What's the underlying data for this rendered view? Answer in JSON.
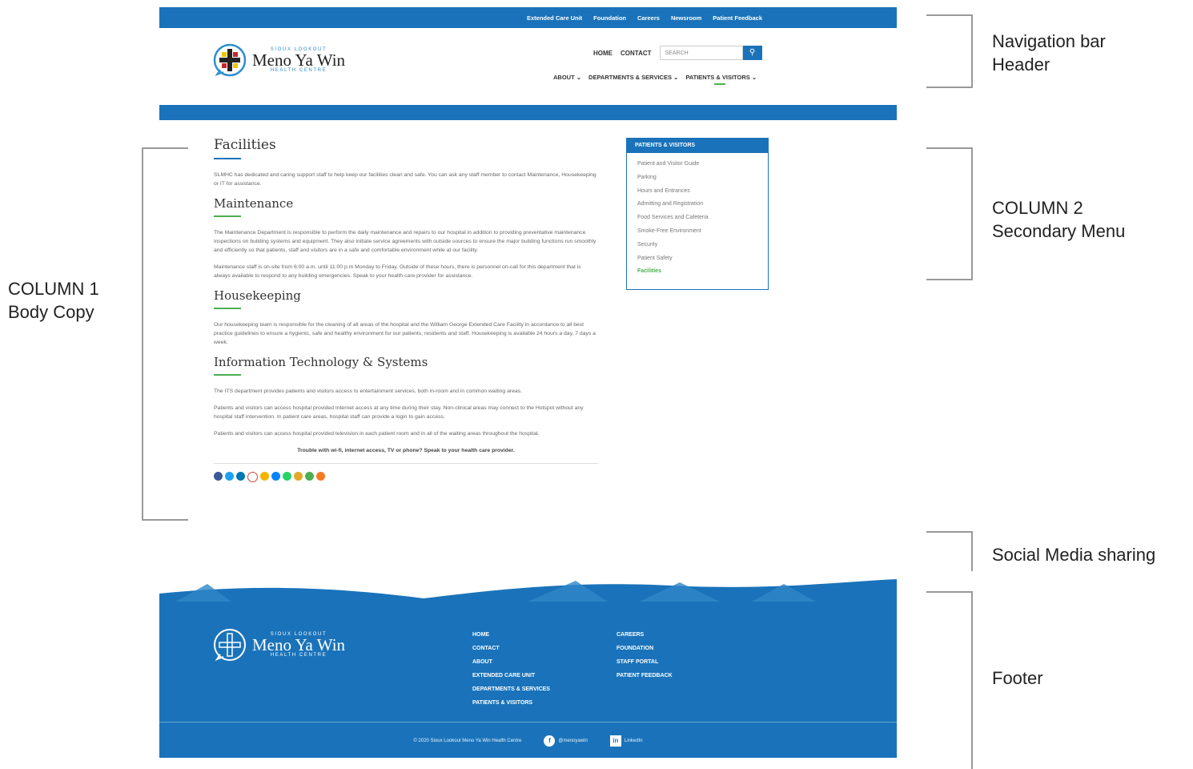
{
  "topbar": {
    "links": [
      "Extended Care Unit",
      "Foundation",
      "Careers",
      "Newsroom",
      "Patient Feedback"
    ]
  },
  "logo": {
    "line1": "SIOUX LOOKOUT",
    "line2": "Meno Ya Win",
    "line3": "HEALTH CENTRE"
  },
  "utility": {
    "home": "HOME",
    "contact": "CONTACT",
    "search_placeholder": "SEARCH",
    "search_icon": "search-icon"
  },
  "mainnav": [
    "ABOUT ⌄",
    "DEPARTMENTS & SERVICES ⌄",
    "PATIENTS & VISITORS ⌄"
  ],
  "content": {
    "title": "Facilities",
    "intro": "SLMHC has dedicated and caring support staff to help keep our facilities clean and safe.   You can ask any staff member to contact Maintenance, Housekeeping or IT for assistance.",
    "maintenance": {
      "heading": "Maintenance",
      "p1": "The Maintenance Department is responsible to perform the daily maintenance and repairs to our hospital in addition to providing preventative maintenance inspections on building systems and equipment. They also initiate service agreements with outside sources to ensure the major building functions run smoothly and efficiently so that patients, staff and visitors are in a safe and comfortable environment while at our facility.",
      "p2": "Maintenance staff is on-site from 6:00 a.m. until 11:00 p.m Monday to Friday. Outside of these hours, there is personnel on-call for this department that is always available to respond to any building emergencies.  Speak to your health care provider for assistance."
    },
    "housekeeping": {
      "heading": "Housekeeping",
      "p1": "Our housekeeping team is responsible for the cleaning of all areas of the hospital and the William George Extended Care Facility in accordance to all best practice guidelines to ensure a hygienic, safe and healthy environment for our patients, residents and staff. Housekeeping is available 24 hours a day, 7 days a week."
    },
    "its": {
      "heading": "Information Technology & Systems",
      "p1": "The ITS department provides patients and visitors access to entertainment services, both in-room and in common waiting areas.",
      "p2": "Patients and visitors can access hospital provided Internet access at any time during their stay. Non-clinical areas may connect to the Hotspot without any hospital staff intervention. In patient care areas, hospital staff can provide a login to gain access.",
      "p3": "Patients and visitors can access hospital provided television in each patient room and in all of the waiting areas throughout the hospital.",
      "note": "Trouble with wi-fi, internet access, TV or phone? Speak to your health care provider."
    },
    "share_icons": [
      {
        "name": "facebook-icon",
        "color": "#3b5998"
      },
      {
        "name": "twitter-icon",
        "color": "#1da1f2"
      },
      {
        "name": "linkedin-icon",
        "color": "#0077b5"
      },
      {
        "name": "gmail-icon",
        "color": "#ffffff"
      },
      {
        "name": "email-icon",
        "color": "#f4b400"
      },
      {
        "name": "messenger-icon",
        "color": "#0084ff"
      },
      {
        "name": "whatsapp-icon",
        "color": "#25d366"
      },
      {
        "name": "pinterest-icon",
        "color": "#e2a92a"
      },
      {
        "name": "sms-icon",
        "color": "#4caf50"
      },
      {
        "name": "share-icon",
        "color": "#f47c20"
      }
    ]
  },
  "sidebar": {
    "heading": "PATIENTS & VISITORS",
    "items": [
      "Patient and Visitor Guide",
      "Parking",
      "Hours and Entrances",
      "Admitting and Registration",
      "Food Services and Cafeteria",
      "Smoke-Free Environment",
      "Security",
      "Patient Safety",
      "Facilities"
    ]
  },
  "footer": {
    "col1": [
      "HOME",
      "CONTACT",
      "ABOUT",
      "EXTENDED CARE UNIT",
      "DEPARTMENTS & SERVICES",
      "PATIENTS & VISITORS"
    ],
    "col2": [
      "CAREERS",
      "FOUNDATION",
      "STAFF PORTAL",
      "PATIENT FEEDBACK"
    ],
    "copyright": "© 2020 Sioux Lookout Meno Ya Win Health Centre",
    "facebook_handle": "@menoyawin",
    "linkedin_label": "LinkedIn"
  },
  "annotations": {
    "nav_header": [
      "Navigation bar",
      "Header"
    ],
    "column1": [
      "COLUMN 1",
      "Body Copy"
    ],
    "column2": [
      "COLUMN 2",
      "Secondary Menu"
    ],
    "social": "Social Media sharing",
    "footer": "Footer"
  },
  "colors": {
    "brand_blue": "#1a73ba",
    "accent_green": "#4caf50"
  }
}
